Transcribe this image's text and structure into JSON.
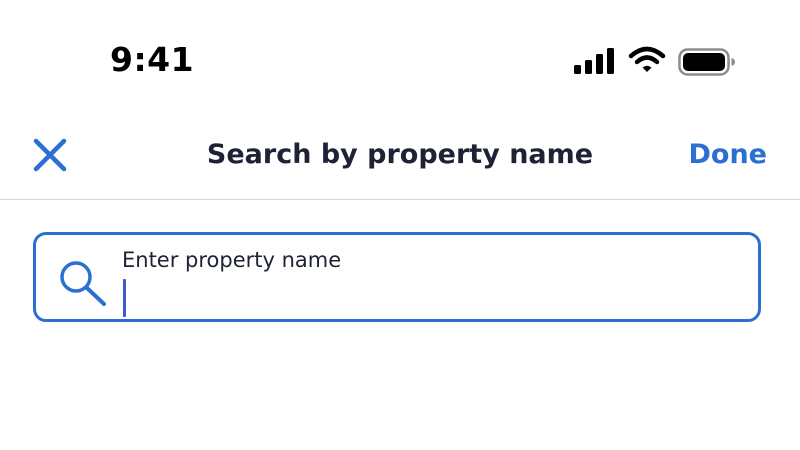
{
  "status_bar": {
    "time": "9:41",
    "icons": [
      "signal-icon",
      "wifi-icon",
      "battery-icon"
    ]
  },
  "header": {
    "title": "Search by property name",
    "close_icon": "close-icon",
    "done_label": "Done"
  },
  "search": {
    "label": "Enter property name",
    "value": "",
    "icon": "search-icon"
  },
  "colors": {
    "accent": "#2a6fd1",
    "text": "#1e2235",
    "divider": "#d6d6d6",
    "caret": "#3b5bcc"
  }
}
